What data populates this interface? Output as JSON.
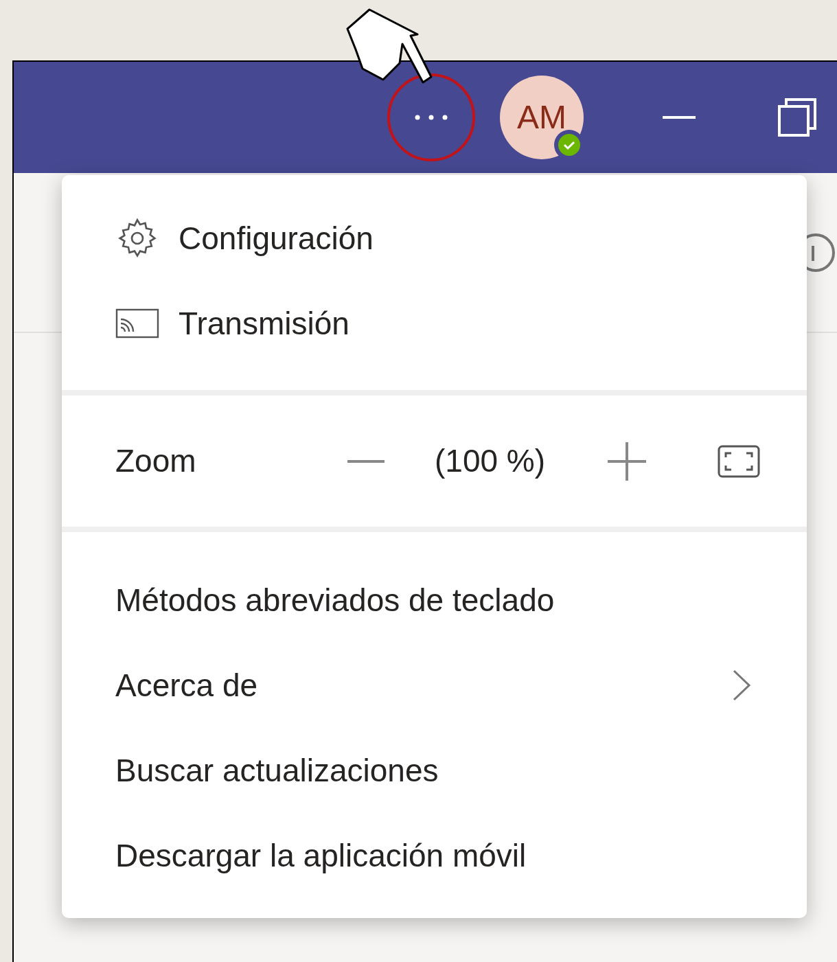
{
  "title_bar": {
    "avatar": {
      "initials": "AM",
      "online": true
    }
  },
  "menu": {
    "sections": [
      {
        "kind": "icon_items",
        "items": [
          {
            "label": "Configuración",
            "submenu": false
          },
          {
            "label": "Transmisión",
            "submenu": false
          }
        ]
      },
      {
        "kind": "zoom",
        "label": "Zoom",
        "reading": "(100 %)"
      },
      {
        "kind": "items",
        "items": [
          {
            "label": "Métodos abreviados de teclado",
            "submenu": false
          },
          {
            "label": "Acerca de",
            "submenu": true
          },
          {
            "label": "Buscar actualizaciones",
            "submenu": false
          },
          {
            "label": "Descargar la aplicación móvil",
            "submenu": false
          }
        ]
      }
    ]
  }
}
